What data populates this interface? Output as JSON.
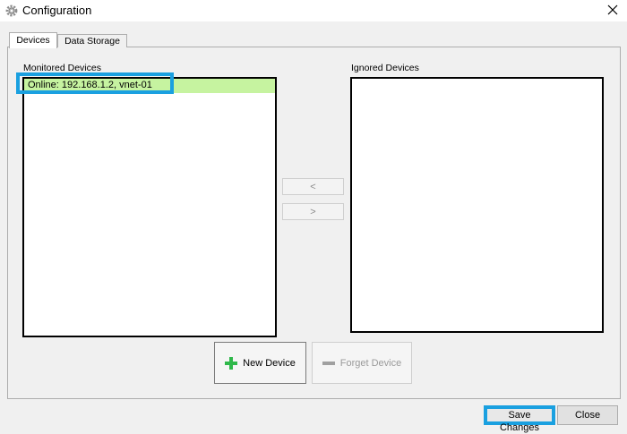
{
  "window": {
    "title": "Configuration",
    "icon": "gear-icon",
    "close_icon": "close-icon"
  },
  "tabs": [
    {
      "label": "Devices",
      "active": true
    },
    {
      "label": "Data Storage",
      "active": false
    }
  ],
  "monitored": {
    "label": "Monitored Devices",
    "items": [
      {
        "text": "Online:  192.168.1.2, vnet-01",
        "selected": true,
        "highlight_color": "#c6f3a0"
      }
    ]
  },
  "ignored": {
    "label": "Ignored Devices",
    "items": []
  },
  "transfer": {
    "left_label": "<",
    "right_label": ">"
  },
  "actions": {
    "new_device_label": "New Device",
    "forget_device_label": "Forget Device"
  },
  "footer": {
    "save_label": "Save Changes",
    "close_label": "Close"
  },
  "colors": {
    "annotation_box": "#1aa0e0",
    "selected_row": "#c6f3a0",
    "plus_icon": "#2fb84a"
  }
}
